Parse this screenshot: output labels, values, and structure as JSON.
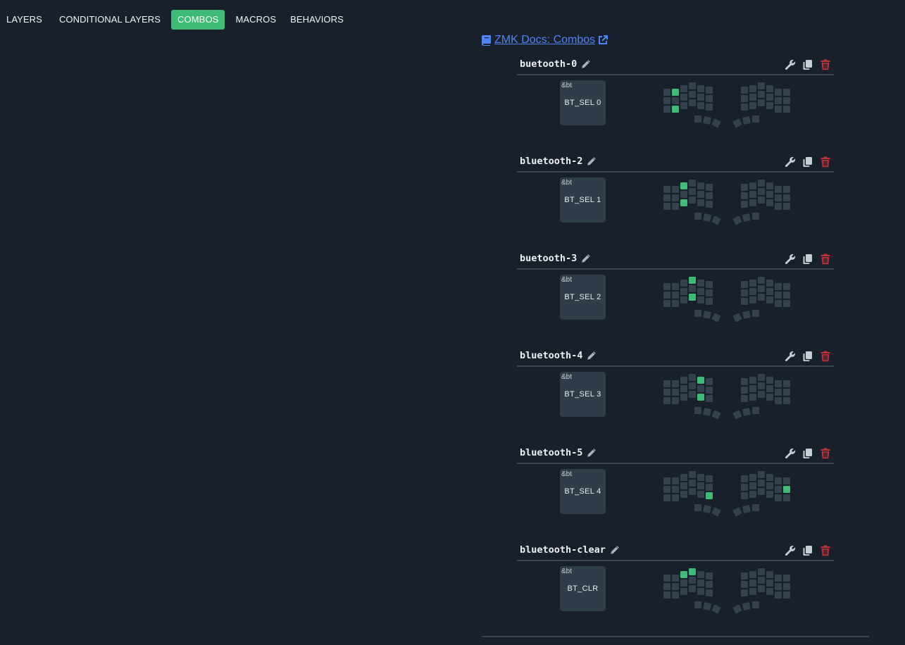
{
  "tabs": [
    {
      "label": "LAYERS",
      "active": false
    },
    {
      "label": "CONDITIONAL LAYERS",
      "active": false
    },
    {
      "label": "COMBOS",
      "active": true
    },
    {
      "label": "MACROS",
      "active": false
    },
    {
      "label": "BEHAVIORS",
      "active": false
    }
  ],
  "docs_link": {
    "label": "ZMK Docs: Combos",
    "icon": "book-icon",
    "external_icon": "external-link-icon"
  },
  "colors": {
    "accent": "#3dbc75",
    "link": "#4f86f7",
    "delete": "#c0313a",
    "key": "#344250",
    "background": "#18212b"
  },
  "combos": [
    {
      "name": "buetooth-0",
      "behavior": "&bt",
      "param": "BT_SEL 0",
      "selected_keys": [
        1,
        13
      ]
    },
    {
      "name": "bluetooth-2",
      "behavior": "&bt",
      "param": "BT_SEL 1",
      "selected_keys": [
        2,
        14
      ]
    },
    {
      "name": "buetooth-3",
      "behavior": "&bt",
      "param": "BT_SEL 2",
      "selected_keys": [
        3,
        15
      ]
    },
    {
      "name": "bluetooth-4",
      "behavior": "&bt",
      "param": "BT_SEL 3",
      "selected_keys": [
        4,
        16
      ]
    },
    {
      "name": "bluetooth-5",
      "behavior": "&bt",
      "param": "BT_SEL 4",
      "selected_keys": [
        17,
        29
      ]
    },
    {
      "name": "bluetooth-clear",
      "behavior": "&bt",
      "param": "BT_CLR",
      "selected_keys": [
        2,
        3
      ]
    }
  ],
  "combo_actions": [
    "wrench-icon",
    "copy-icon",
    "trash-icon"
  ]
}
